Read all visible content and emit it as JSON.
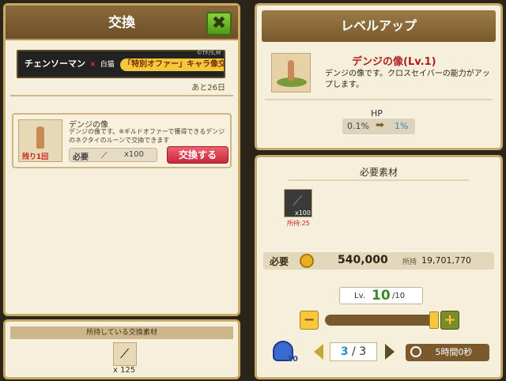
{
  "left": {
    "title": "交換",
    "close": "✖",
    "banner": {
      "text1": "チェンソーマン",
      "x": "×",
      "logo": "白猫",
      "subtitle": "NEW WORLD'S",
      "offer": "「特別オファー」キャラ像交換",
      "copyright": "©TF/S,M"
    },
    "remaining_days": "あと26日",
    "item": {
      "remaining": "残り1回",
      "name": "デンジの像",
      "desc": "デンジの像です。※ギルドオファーで獲得できるデンジのネクタイのルーンで交換できます",
      "required_label": "必要",
      "required_count": "x100",
      "exchange_button": "交換する"
    },
    "owned_title": "所持している交換素材",
    "owned_count": "x 125"
  },
  "right": {
    "title": "レベルアップ",
    "item_name": "デンジの像(Lv.1)",
    "item_desc": "デンジの像です。クロスセイバーの能力がアップします。",
    "stat_label": "HP",
    "stat_from": "0.1%",
    "stat_to": "1%",
    "materials_title": "必要素材",
    "material_count": "x100",
    "material_owned": "所持:25",
    "cost_label": "必要",
    "cost_value": "540,000",
    "owned_label": "所持",
    "owned_value": "19,701,770",
    "level_prefix": "Lv.",
    "level_value": "10",
    "level_max": "/10",
    "minus": "−",
    "plus": "+",
    "slider_fraction": 1.0,
    "page_current": "3",
    "page_sep": "/",
    "page_total": "3",
    "timer": "5時間0秒",
    "potion_count": "10"
  }
}
